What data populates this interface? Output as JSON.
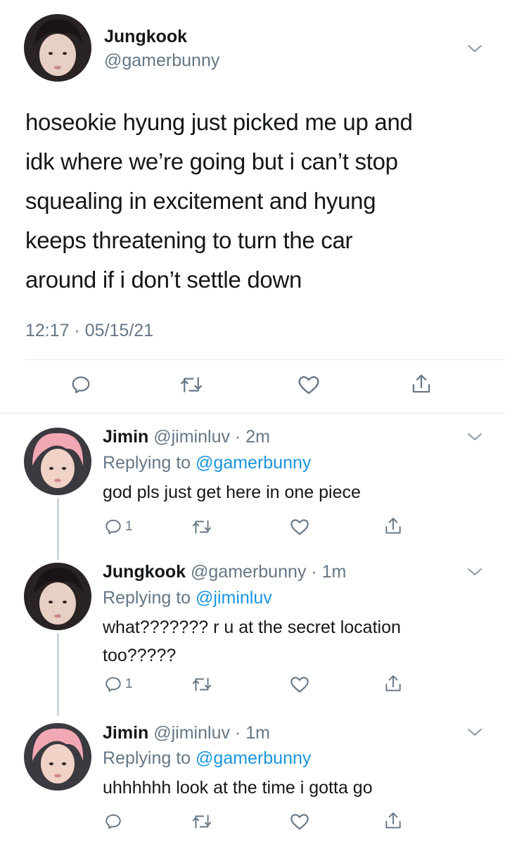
{
  "main_tweet": {
    "author_name": "Jungkook",
    "author_handle": "@gamerbunny",
    "text_lines": [
      "hoseokie hyung just picked me up and",
      "idk where we’re going but i can’t stop",
      "squealing in excitement and hyung",
      "keeps threatening to turn the car",
      "around if i don’t settle down"
    ],
    "timestamp": "12:17 · 05/15/21",
    "actions": [
      "reply-icon",
      "retweet-icon",
      "like-icon",
      "share-icon"
    ]
  },
  "replies": [
    {
      "name": "Jimin",
      "handle_time": " @jiminluv · 2m",
      "replying_prefix": "Replying to ",
      "replying_to": "@gamerbunny",
      "text": "god pls just get here in one piece",
      "reply_count": "1"
    },
    {
      "name": "Jungkook",
      "handle_time": " @gamerbunny · 1m",
      "replying_prefix": "Replying to ",
      "replying_to": "@jiminluv",
      "text": "what??????? r u at the secret location too?????",
      "reply_count": "1"
    },
    {
      "name": "Jimin",
      "handle_time": " @jiminluv · 1m",
      "replying_prefix": "Replying to ",
      "replying_to": "@gamerbunny",
      "text": "uhhhhhh look at the time i gotta go",
      "reply_count": ""
    }
  ],
  "colors": {
    "secondary_text": "#657786",
    "link": "#1b95e0",
    "divider": "#e1e8ed",
    "thread_line": "#ccd6dd"
  }
}
